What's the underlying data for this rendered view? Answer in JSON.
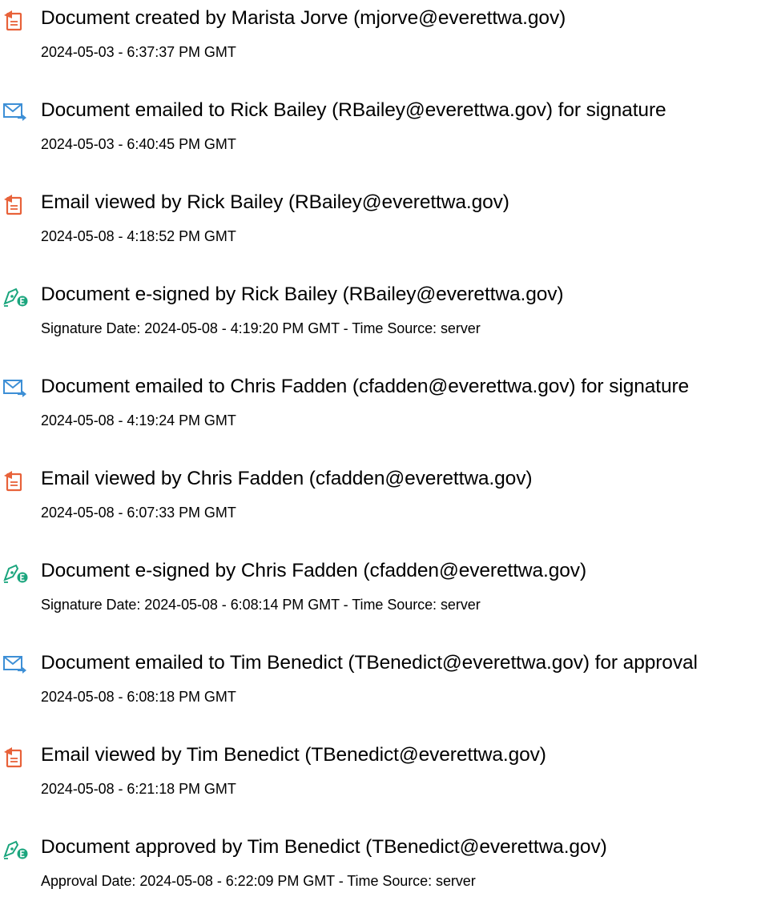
{
  "colors": {
    "doc_icon": "#e8623a",
    "email_icon": "#3d8fd6",
    "sign_icon": "#1aa57d",
    "text": "#000000"
  },
  "events": [
    {
      "icon": "document-icon",
      "title": "Document created by Marista Jorve (mjorve@everettwa.gov)",
      "detail": "2024-05-03 - 6:37:37 PM GMT"
    },
    {
      "icon": "email-icon",
      "title": "Document emailed to Rick Bailey (RBailey@everettwa.gov) for signature",
      "detail": "2024-05-03 - 6:40:45 PM GMT"
    },
    {
      "icon": "document-icon",
      "title": "Email viewed by Rick Bailey (RBailey@everettwa.gov)",
      "detail": "2024-05-08 - 4:18:52 PM GMT"
    },
    {
      "icon": "esign-icon",
      "title": "Document e-signed by Rick Bailey (RBailey@everettwa.gov)",
      "detail": "Signature Date: 2024-05-08 - 4:19:20 PM GMT - Time Source: server"
    },
    {
      "icon": "email-icon",
      "title": "Document emailed to Chris Fadden (cfadden@everettwa.gov) for signature",
      "detail": "2024-05-08 - 4:19:24 PM GMT"
    },
    {
      "icon": "document-icon",
      "title": "Email viewed by Chris Fadden (cfadden@everettwa.gov)",
      "detail": "2024-05-08 - 6:07:33 PM GMT"
    },
    {
      "icon": "esign-icon",
      "title": "Document e-signed by Chris Fadden (cfadden@everettwa.gov)",
      "detail": "Signature Date: 2024-05-08 - 6:08:14 PM GMT - Time Source: server"
    },
    {
      "icon": "email-icon",
      "title": "Document emailed to Tim Benedict (TBenedict@everettwa.gov) for approval",
      "detail": "2024-05-08 - 6:08:18 PM GMT"
    },
    {
      "icon": "document-icon",
      "title": "Email viewed by Tim Benedict (TBenedict@everettwa.gov)",
      "detail": "2024-05-08 - 6:21:18 PM GMT"
    },
    {
      "icon": "esign-icon",
      "title": "Document approved by Tim Benedict (TBenedict@everettwa.gov)",
      "detail": "Approval Date: 2024-05-08 - 6:22:09 PM GMT - Time Source: server"
    }
  ]
}
